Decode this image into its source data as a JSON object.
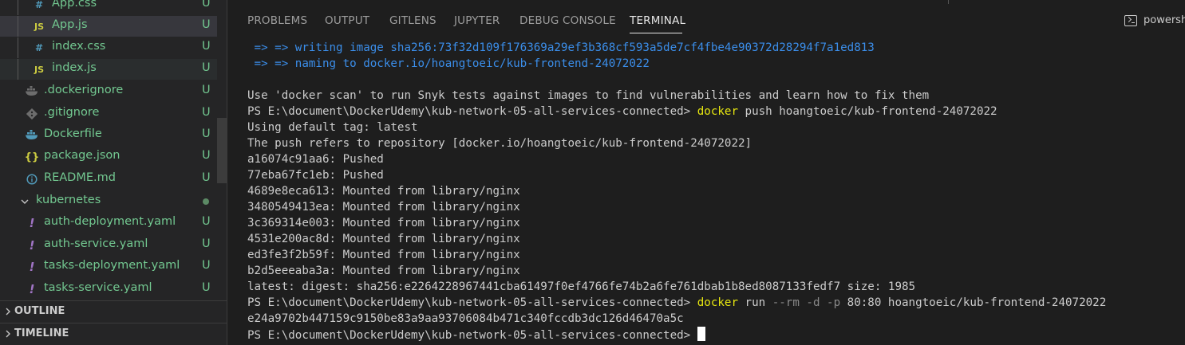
{
  "explorer": {
    "items": [
      {
        "name": "App.css",
        "icon": "#",
        "status": "U"
      },
      {
        "name": "App.js",
        "icon": "JS",
        "status": "U"
      },
      {
        "name": "index.css",
        "icon": "#",
        "status": "U"
      },
      {
        "name": "index.js",
        "icon": "JS",
        "status": "U"
      },
      {
        "name": ".dockerignore",
        "icon": "docker",
        "status": "U"
      },
      {
        "name": ".gitignore",
        "icon": "git",
        "status": "U"
      },
      {
        "name": "Dockerfile",
        "icon": "docker",
        "status": "U"
      },
      {
        "name": "package.json",
        "icon": "{}",
        "status": "U"
      },
      {
        "name": "README.md",
        "icon": "i",
        "status": "U"
      },
      {
        "name": "kubernetes",
        "icon": "chevron",
        "status": ""
      },
      {
        "name": "auth-deployment.yaml",
        "icon": "!",
        "status": "U"
      },
      {
        "name": "auth-service.yaml",
        "icon": "!",
        "status": "U"
      },
      {
        "name": "tasks-deployment.yaml",
        "icon": "!",
        "status": "U"
      },
      {
        "name": "tasks-service.yaml",
        "icon": "!",
        "status": "U"
      }
    ]
  },
  "sections": {
    "outline": "OUTLINE",
    "timeline": "TIMELINE"
  },
  "panel": {
    "tabs": [
      "PROBLEMS",
      "OUTPUT",
      "GITLENS",
      "JUPYTER",
      "DEBUG CONSOLE",
      "TERMINAL"
    ],
    "active_tab": "TERMINAL",
    "terminal_name": "powersh"
  },
  "terminal": {
    "l1_arrows": " => => ",
    "l1_text": "writing image sha256:73f32d109f176369a29ef3b368cf593a5de7cf4fbe4e90372d28294f7a1ed813",
    "l2_arrows": " => => ",
    "l2_text": "naming to docker.io/hoangtoeic/kub-frontend-24072022",
    "l4": "Use 'docker scan' to run Snyk tests against images to find vulnerabilities and learn how to fix them",
    "prompt": "PS E:\\document\\DockerUdemy\\kub-network-05-all-services-connected> ",
    "cmd": "docker",
    "l5_args": " push hoangtoeic/kub-frontend-24072022",
    "l6": "Using default tag: latest",
    "l7": "The push refers to repository [docker.io/hoangtoeic/kub-frontend-24072022]",
    "layers": [
      "a16074c91aa6: Pushed",
      "77eba67fc1eb: Pushed",
      "4689e8eca613: Mounted from library/nginx",
      "3480549413ea: Mounted from library/nginx",
      "3c369314e003: Mounted from library/nginx",
      "4531e200ac8d: Mounted from library/nginx",
      "ed3fe3f2b59f: Mounted from library/nginx",
      "b2d5eeeaba3a: Mounted from library/nginx"
    ],
    "digest": "latest: digest: sha256:e2264228967441cba61497f0ef4766fe74b2a6fe761dbab1b8ed8087133fedf7 size: 1985",
    "run_a": " run ",
    "run_flags": "--rm -d -p",
    "run_b": " 80:80 hoangtoeic/kub-frontend-24072022",
    "container_id": "e24a9702b447159c9150be83a9aa93706084b471c340fccdb3dc126d46470a5c"
  },
  "colors": {
    "untracked": "#73c991",
    "arrow_blue": "#3b8eea",
    "command_yellow": "#e5e510",
    "js_yellow": "#cbcb41",
    "css_blue": "#519aba",
    "yaml_purple": "#a074c4"
  }
}
